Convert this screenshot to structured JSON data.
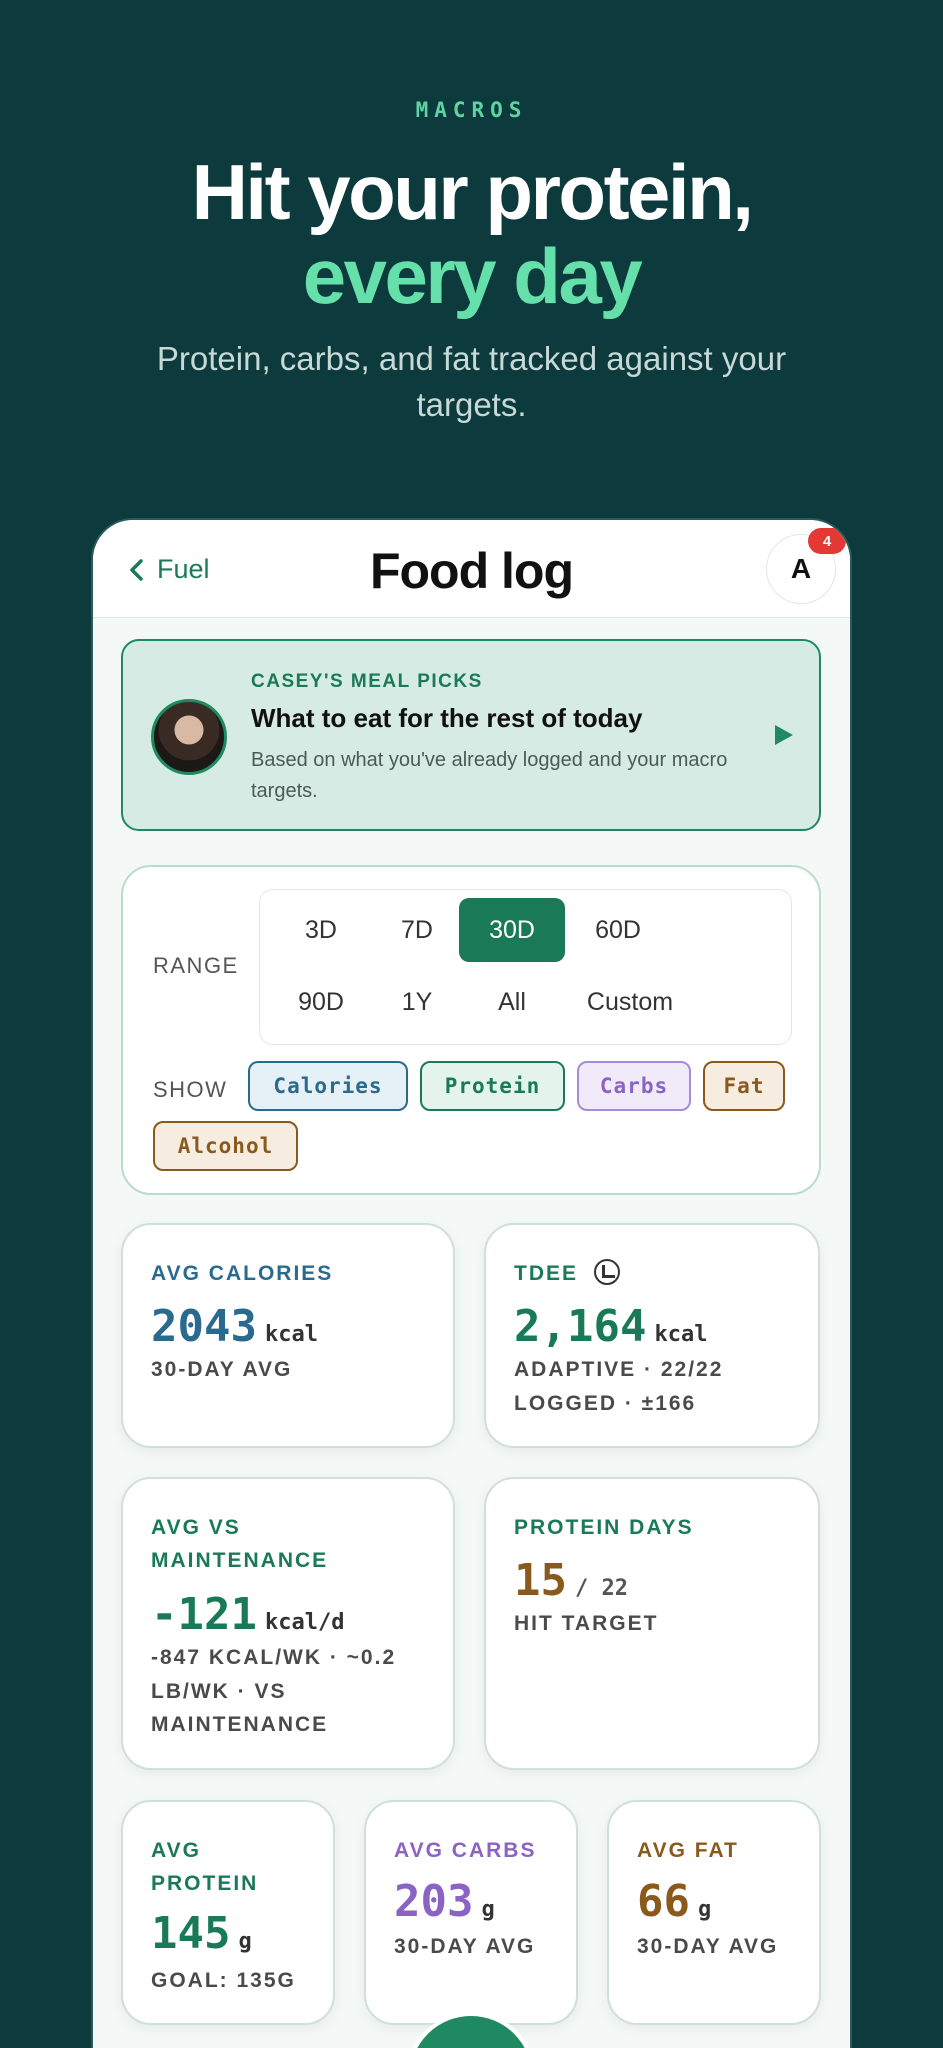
{
  "hero": {
    "eyebrow": "MACROS",
    "headline_line1": "Hit your protein,",
    "headline_line2": "every day",
    "subhead": "Protein, carbs, and fat tracked against your targets."
  },
  "topbar": {
    "back_label": "Fuel",
    "title": "Food log",
    "avatar_letter": "A",
    "notification_count": "4"
  },
  "picks": {
    "kicker": "CASEY'S MEAL PICKS",
    "title": "What to eat for the rest of today",
    "description": "Based on what you've already logged and your macro targets."
  },
  "filters": {
    "range_label": "RANGE",
    "ranges": [
      "3D",
      "7D",
      "30D",
      "60D",
      "90D",
      "1Y",
      "All",
      "Custom"
    ],
    "selected_range": "30D",
    "show_label": "SHOW",
    "chips": [
      "Calories",
      "Protein",
      "Carbs",
      "Fat",
      "Alcohol"
    ]
  },
  "stats": {
    "avg_calories": {
      "label": "AVG CALORIES",
      "value": "2043",
      "unit": "kcal",
      "sub": "30-DAY AVG"
    },
    "tdee": {
      "label": "TDEE",
      "value": "2,164",
      "unit": "kcal",
      "sub1": "ADAPTIVE · 22/22",
      "sub2": "LOGGED · ±166"
    },
    "avg_vs_maint": {
      "label1": "AVG VS",
      "label2": "MAINTENANCE",
      "value": "-121",
      "unit": "kcal/d",
      "sub1": "-847 KCAL/WK · ~0.2",
      "sub2": "LB/WK · VS",
      "sub3": "MAINTENANCE"
    },
    "protein_days": {
      "label": "PROTEIN DAYS",
      "value": "15",
      "denominator": "/ 22",
      "sub": "HIT TARGET"
    },
    "avg_protein": {
      "label1": "AVG",
      "label2": "PROTEIN",
      "value": "145",
      "unit": "g",
      "sub": "GOAL: 135G"
    },
    "avg_carbs": {
      "label": "AVG CARBS",
      "value": "203",
      "unit": "g",
      "sub": "30-DAY AVG"
    },
    "avg_fat": {
      "label": "AVG FAT",
      "value": "66",
      "unit": "g",
      "sub": "30-DAY AVG"
    }
  },
  "colors": {
    "background": "#0d3a3c",
    "accent_green": "#1a7a58",
    "calories_blue": "#2a6a8e",
    "carbs_purple": "#8a63c4",
    "fat_brown": "#8a5a1c"
  }
}
